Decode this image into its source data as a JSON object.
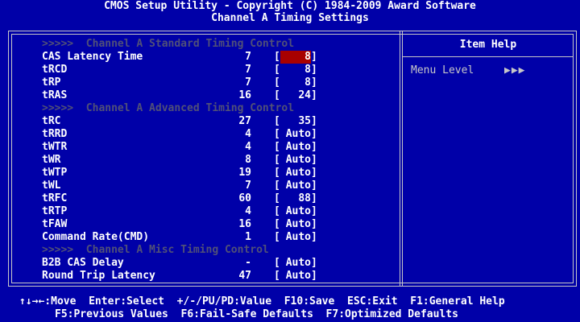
{
  "header": {
    "title": "CMOS Setup Utility - Copyright (C) 1984-2009 Award Software",
    "subtitle": "Channel A Timing Settings"
  },
  "help": {
    "title": "Item Help",
    "menu_level_label": "Menu Level",
    "menu_level_arrows": "▶▶▶"
  },
  "rows": [
    {
      "type": "section",
      "text": ">>>>>  Channel A Standard Timing Control"
    },
    {
      "type": "item",
      "label": "CAS Latency Time",
      "current": "7",
      "setting": "8",
      "selected": true
    },
    {
      "type": "item",
      "label": "tRCD",
      "current": "7",
      "setting": "8"
    },
    {
      "type": "item",
      "label": "tRP",
      "current": "7",
      "setting": "8"
    },
    {
      "type": "item",
      "label": "tRAS",
      "current": "16",
      "setting": "24"
    },
    {
      "type": "section",
      "text": ">>>>>  Channel A Advanced Timing Control"
    },
    {
      "type": "item",
      "label": "tRC",
      "current": "27",
      "setting": "35"
    },
    {
      "type": "item",
      "label": "tRRD",
      "current": "4",
      "setting": "Auto"
    },
    {
      "type": "item",
      "label": "tWTR",
      "current": "4",
      "setting": "Auto"
    },
    {
      "type": "item",
      "label": "tWR",
      "current": "8",
      "setting": "Auto"
    },
    {
      "type": "item",
      "label": "tWTP",
      "current": "19",
      "setting": "Auto"
    },
    {
      "type": "item",
      "label": "tWL",
      "current": "7",
      "setting": "Auto"
    },
    {
      "type": "item",
      "label": "tRFC",
      "current": "60",
      "setting": "88"
    },
    {
      "type": "item",
      "label": "tRTP",
      "current": "4",
      "setting": "Auto"
    },
    {
      "type": "item",
      "label": "tFAW",
      "current": "16",
      "setting": "Auto"
    },
    {
      "type": "item",
      "label": "Command Rate(CMD)",
      "current": "1",
      "setting": "Auto"
    },
    {
      "type": "section",
      "text": ">>>>>  Channel A Misc Timing Control"
    },
    {
      "type": "item",
      "label": "B2B CAS Delay",
      "current": "-",
      "setting": "Auto"
    },
    {
      "type": "item",
      "label": "Round Trip Latency",
      "current": "47",
      "setting": "Auto"
    }
  ],
  "footer": {
    "line1": "↑↓→←:Move  Enter:Select  +/-/PU/PD:Value  F10:Save  ESC:Exit  F1:General Help",
    "line2": "F5:Previous Values  F6:Fail-Safe Defaults  F7:Optimized Defaults"
  },
  "colors": {
    "background": "#0000a8",
    "frame": "#c8c8c8",
    "text": "#ffffff",
    "section_text": "#505078",
    "highlight": "#a80000"
  }
}
